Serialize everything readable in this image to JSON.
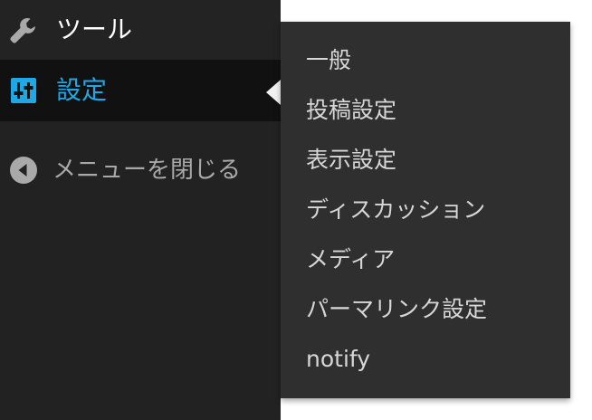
{
  "sidebar": {
    "tools": {
      "label": "ツール",
      "icon": "wrench-icon"
    },
    "settings": {
      "label": "設定",
      "icon": "sliders-icon",
      "accent": "#1ea8e6"
    },
    "collapse": {
      "label": "メニューを閉じる",
      "icon": "collapse-arrow-icon"
    }
  },
  "flyout": {
    "items": [
      "一般",
      "投稿設定",
      "表示設定",
      "ディスカッション",
      "メディア",
      "パーマリンク設定",
      "notify"
    ]
  },
  "colors": {
    "sidebar_bg": "#222222",
    "active_bg": "#111111",
    "flyout_bg": "#2f2f2f",
    "accent": "#1ea8e6"
  }
}
